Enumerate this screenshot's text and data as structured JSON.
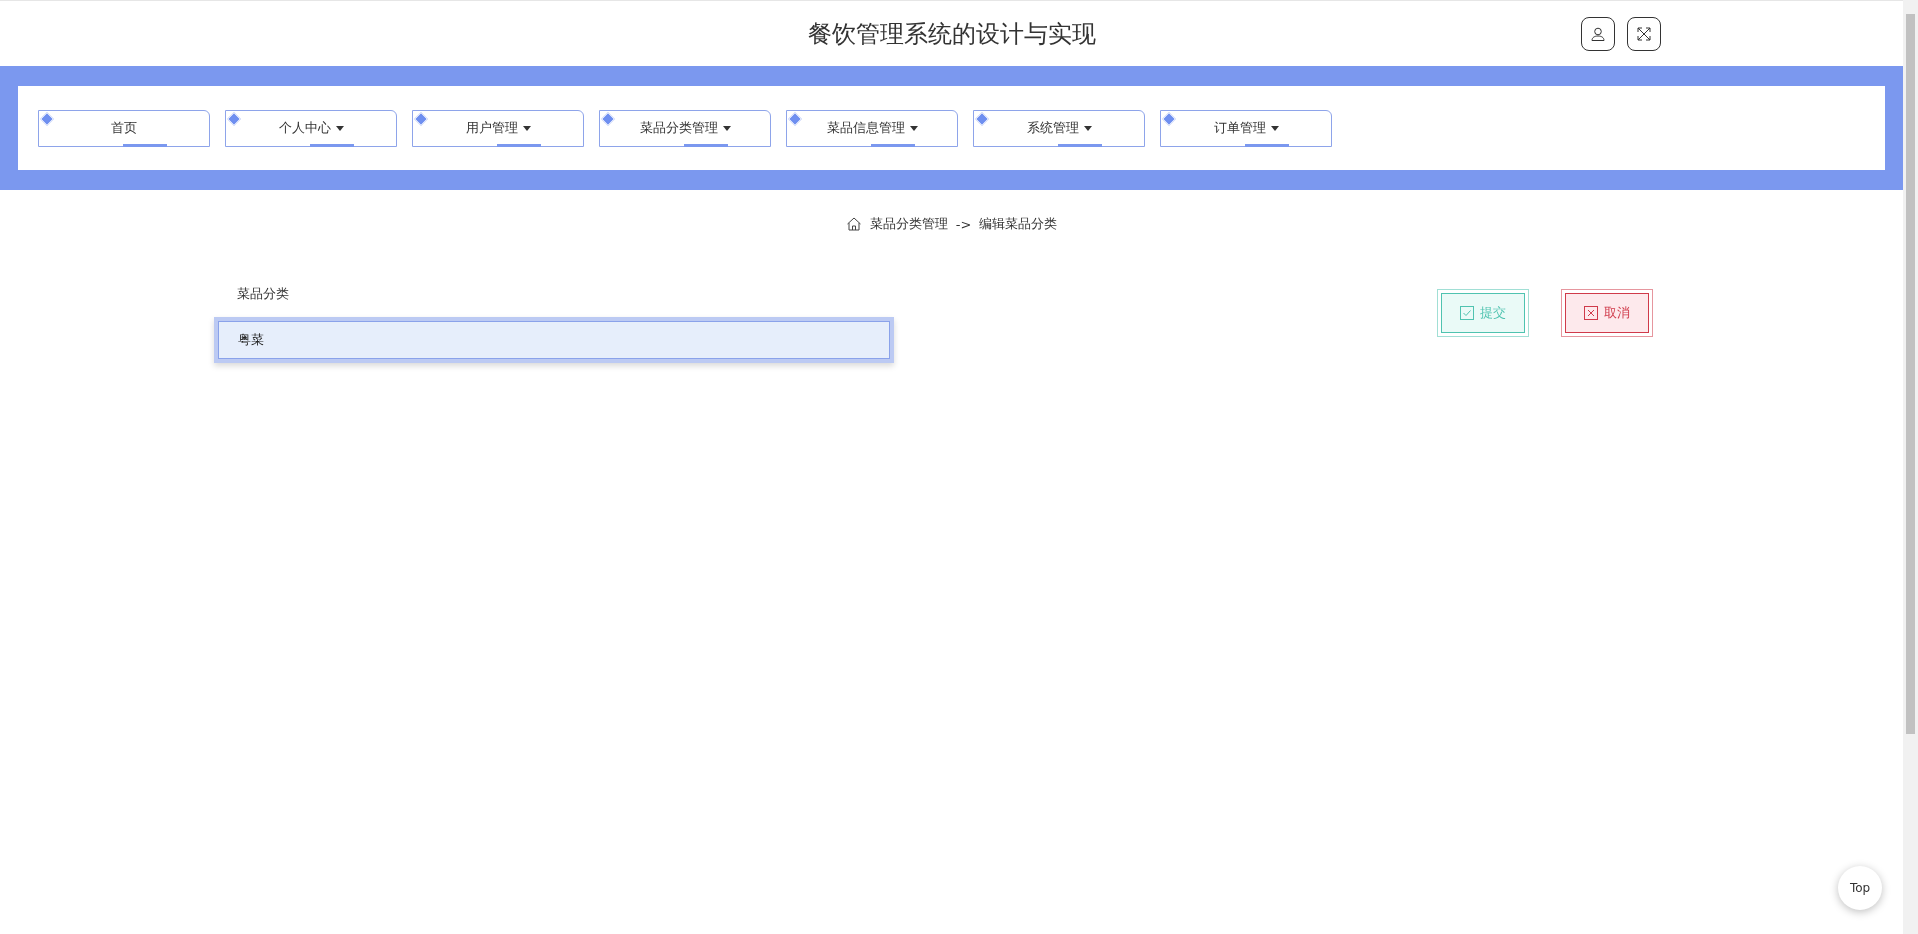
{
  "header": {
    "title": "餐饮管理系统的设计与实现"
  },
  "nav": [
    {
      "label": "首页",
      "has_menu": false
    },
    {
      "label": "个人中心",
      "has_menu": true
    },
    {
      "label": "用户管理",
      "has_menu": true
    },
    {
      "label": "菜品分类管理",
      "has_menu": true
    },
    {
      "label": "菜品信息管理",
      "has_menu": true
    },
    {
      "label": "系统管理",
      "has_menu": true
    },
    {
      "label": "订单管理",
      "has_menu": true
    }
  ],
  "breadcrumb": {
    "section": "菜品分类管理",
    "separator": "->",
    "page": "编辑菜品分类"
  },
  "form": {
    "label": "菜品分类",
    "value": "粤菜"
  },
  "buttons": [
    {
      "label": "提交",
      "kind": "submit"
    },
    {
      "label": "取消",
      "kind": "cancel"
    }
  ],
  "back_to_top": "Top"
}
